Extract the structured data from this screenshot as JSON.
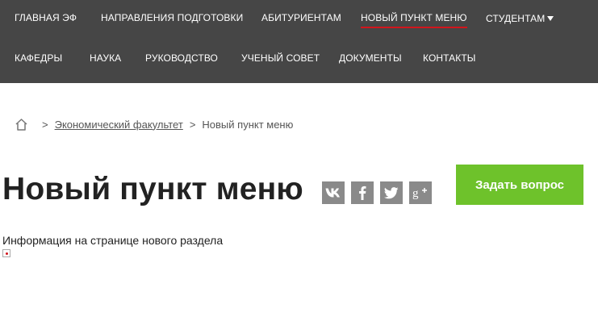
{
  "nav": {
    "row1": [
      "ГЛАВНАЯ ЭФ",
      "НАПРАВЛЕНИЯ ПОДГОТОВКИ",
      "АБИТУРИЕНТАМ",
      "НОВЫЙ ПУНКТ МЕНЮ",
      "СТУДЕНТАМ"
    ],
    "row2": [
      "КАФЕДРЫ",
      "НАУКА",
      "РУКОВОДСТВО",
      "УЧЕНЫЙ СОВЕТ",
      "ДОКУМЕНТЫ",
      "КОНТАКТЫ"
    ],
    "active_item": "НОВЫЙ ПУНКТ МЕНЮ",
    "background_color": "#464646",
    "active_underline_color": "#d2151c"
  },
  "breadcrumb": {
    "separator": ">",
    "items": [
      "Экономический факультет"
    ],
    "current": "Новый пункт меню"
  },
  "page": {
    "title": "Новый пункт меню",
    "body_text": "Информация на странице нового раздела"
  },
  "social": {
    "icons": [
      "vk-icon",
      "facebook-icon",
      "twitter-icon",
      "google-plus-icon"
    ],
    "color": "#8a8a8a"
  },
  "ask_button": {
    "label": "Задать вопрос",
    "color": "#6ec22b"
  }
}
